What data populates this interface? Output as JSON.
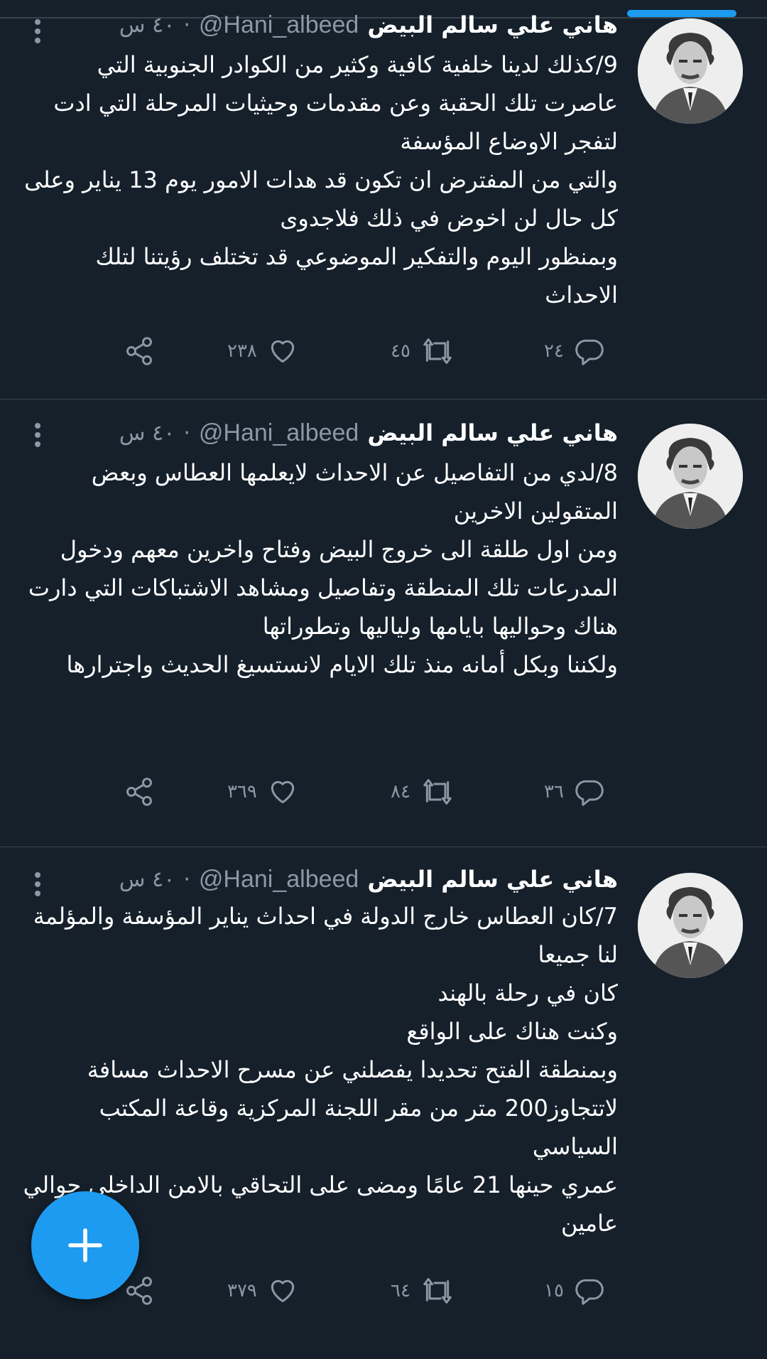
{
  "tweets": [
    {
      "name": "هاني علي سالم البيض",
      "handle": "@Hani_albeed",
      "separator": "·",
      "time": "٤٠ س",
      "text": "9/كذلك لدينا خلفية كافية وكثير من الكوادر الجنوبية التي عاصرت تلك الحقبة وعن مقدمات وحيثيات المرحلة التي ادت لتفجر الاوضاع المؤسفة\nوالتي من المفترض ان تكون قد هدات الامور يوم 13 يناير وعلى كل حال لن اخوض في ذلك فلاجدوى\nوبمنظور اليوم والتفكير الموضوعي قد تختلف رؤيتنا لتلك الاحداث",
      "replies": "٢٤",
      "retweets": "٤٥",
      "likes": "٢٣٨",
      "avatar_icon": "profile-photo"
    },
    {
      "name": "هاني علي سالم البيض",
      "handle": "@Hani_albeed",
      "separator": "·",
      "time": "٤٠ س",
      "text": "8/لدي من التفاصيل عن الاحداث لايعلمها العطاس وبعض المتقولين الاخرين\nومن اول طلقة الى خروج البيض وفتاح واخرين معهم ودخول المدرعات تلك المنطقة وتفاصيل ومشاهد الاشتباكات التي دارت هناك وحواليها بايامها ولياليها وتطوراتها\nولكننا وبكل أمانه منذ تلك الايام لانستسيغ الحديث واجترارها",
      "replies": "٣٦",
      "retweets": "٨٤",
      "likes": "٣٦٩",
      "avatar_icon": "profile-photo"
    },
    {
      "name": "هاني علي سالم البيض",
      "handle": "@Hani_albeed",
      "separator": "·",
      "time": "٤٠ س",
      "text": "7/كان العطاس خارج الدولة في احداث يناير المؤسفة والمؤلمة لنا جميعا\nكان في رحلة بالهند\nوكنت هناك على الواقع\nوبمنطقة الفتح تحديدا يفصلني عن مسرح الاحداث مسافة لاتتجاوز200 متر من مقر اللجنة المركزية وقاعة المكتب السياسي\nعمري حينها 21 عامًا ومضى على التحاقي بالامن الداخلي حوالي عامين",
      "replies": "١٥",
      "retweets": "٦٤",
      "likes": "٣٧٩",
      "avatar_icon": "profile-photo"
    }
  ],
  "icons": {
    "reply": "reply-icon",
    "retweet": "retweet-icon",
    "like": "heart-icon",
    "share": "share-icon",
    "more": "more-vertical-icon",
    "compose": "plus-icon"
  },
  "colors": {
    "background": "#15202b",
    "divider": "#38444d",
    "secondary_text": "#8b98a5",
    "accent": "#1d9bf0"
  }
}
